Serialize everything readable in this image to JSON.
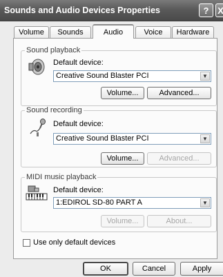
{
  "window": {
    "title": "Sounds and Audio Devices Properties",
    "help_glyph": "?",
    "close_glyph": "X"
  },
  "tabs": [
    {
      "label": "Volume"
    },
    {
      "label": "Sounds"
    },
    {
      "label": "Audio",
      "selected": true
    },
    {
      "label": "Voice"
    },
    {
      "label": "Hardware"
    }
  ],
  "playback": {
    "group_title": "Sound playback",
    "device_label": "Default device:",
    "device_value": "Creative Sound Blaster PCI",
    "volume_button": "Volume...",
    "advanced_button": "Advanced..."
  },
  "recording": {
    "group_title": "Sound recording",
    "device_label": "Default device:",
    "device_value": "Creative Sound Blaster PCI",
    "volume_button": "Volume...",
    "advanced_button": "Advanced..."
  },
  "midi": {
    "group_title": "MIDI music playback",
    "device_label": "Default device:",
    "device_value": "1:EDIROL SD-80 PART A",
    "volume_button": "Volume...",
    "about_button": "About..."
  },
  "options": {
    "use_default_only_label": "Use only default devices",
    "use_default_only_checked": false
  },
  "footer": {
    "ok_label": "OK",
    "cancel_label": "Cancel",
    "apply_label": "Apply"
  },
  "icons": {
    "speaker": "speaker-icon",
    "microphone": "microphone-icon",
    "midi": "midi-keyboard-icon",
    "dropdown": "chevron-down-icon"
  }
}
